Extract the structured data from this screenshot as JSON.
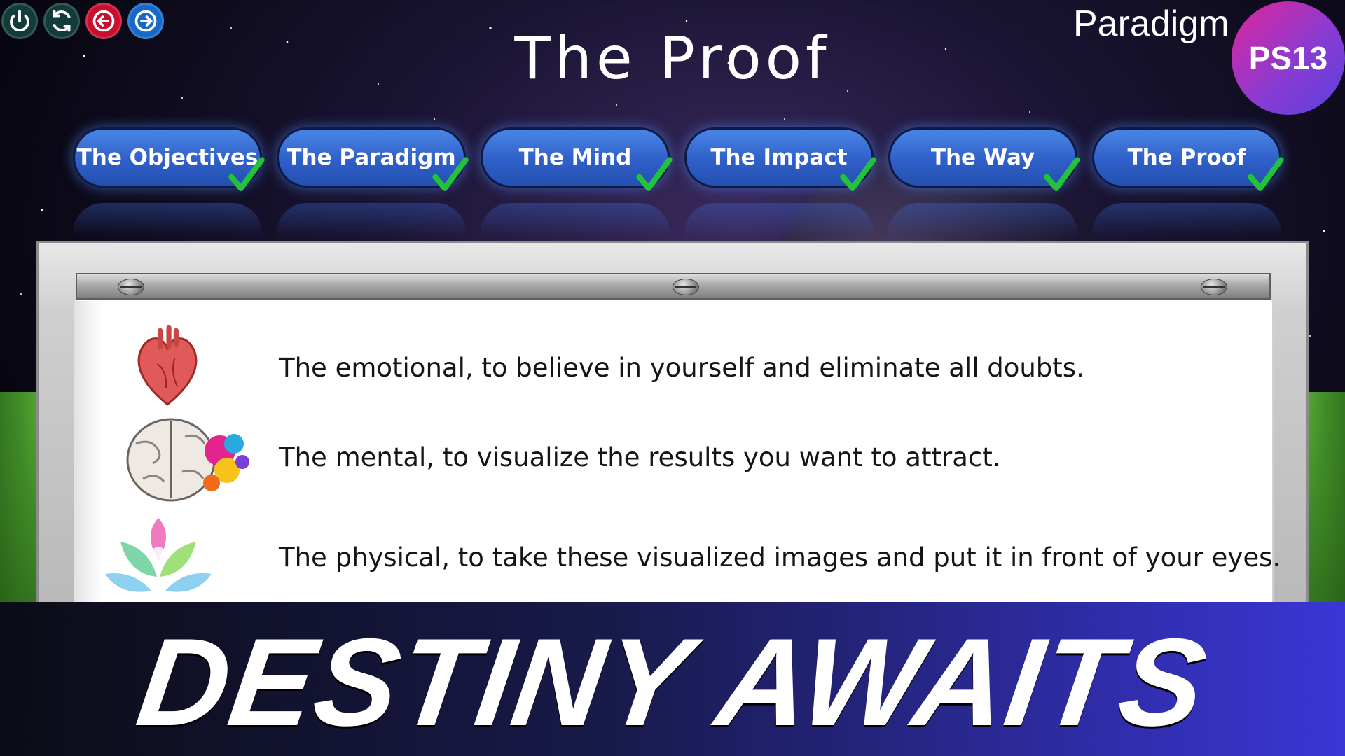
{
  "window": {
    "title": "The Proof",
    "brand": "Paradigm",
    "badge": "PS13"
  },
  "controls": [
    {
      "name": "power",
      "icon": "power-icon"
    },
    {
      "name": "refresh",
      "icon": "refresh-icon"
    },
    {
      "name": "back",
      "icon": "arrow-left-icon",
      "color": "#c8102e"
    },
    {
      "name": "forward",
      "icon": "arrow-right-icon",
      "color": "#1769c8"
    }
  ],
  "tabs": [
    {
      "label": "The Objectives",
      "completed": true
    },
    {
      "label": "The Paradigm",
      "completed": true
    },
    {
      "label": "The Mind",
      "completed": true
    },
    {
      "label": "The Impact",
      "completed": true
    },
    {
      "label": "The Way",
      "completed": true
    },
    {
      "label": "The Proof",
      "completed": true
    }
  ],
  "content": {
    "items": [
      {
        "icon": "heart-icon",
        "text": "The emotional, to believe in yourself and eliminate all doubts."
      },
      {
        "icon": "brain-icon",
        "text": "The mental, to visualize the results you want to attract."
      },
      {
        "icon": "meditation-icon",
        "text": "The physical, to take these visualized images and put it in front of your eyes."
      }
    ]
  },
  "banner": {
    "text": "DESTINY AWAITS"
  },
  "colors": {
    "tab": "#2f5fc8",
    "check": "#22c33a",
    "badge_start": "#e0259a",
    "badge_end": "#5a3fe0",
    "banner_end": "#3a36d6"
  }
}
